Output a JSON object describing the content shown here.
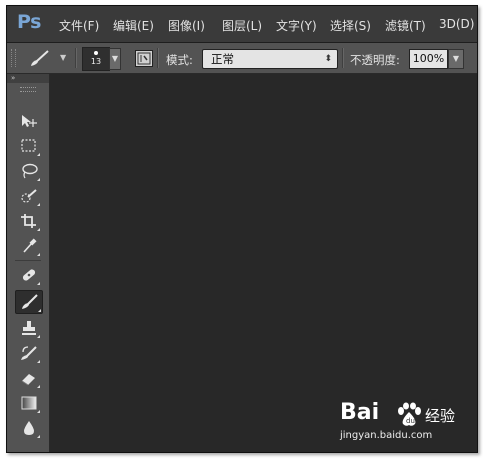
{
  "app": {
    "logo": "Ps"
  },
  "menu": [
    {
      "name": "file",
      "label": "文件(F)"
    },
    {
      "name": "edit",
      "label": "编辑(E)"
    },
    {
      "name": "image",
      "label": "图像(I)"
    },
    {
      "name": "layer",
      "label": "图层(L)"
    },
    {
      "name": "type",
      "label": "文字(Y)"
    },
    {
      "name": "select",
      "label": "选择(S)"
    },
    {
      "name": "filter",
      "label": "滤镜(T)"
    },
    {
      "name": "3d",
      "label": "3D(D)"
    }
  ],
  "options_bar": {
    "brush_size": "13",
    "mode_label": "模式:",
    "mode_value": "正常",
    "opacity_label": "不透明度:",
    "opacity_value": "100%"
  },
  "toolstrip": {
    "collapse_glyph": "»"
  },
  "tools": [
    "move-tool-icon",
    "marquee-tool-icon",
    "lasso-tool-icon",
    "quick-selection-tool-icon",
    "crop-tool-icon",
    "eyedropper-tool-icon",
    "spot-healing-tool-icon",
    "brush-tool-icon",
    "clone-stamp-tool-icon",
    "history-brush-tool-icon",
    "eraser-tool-icon",
    "gradient-tool-icon",
    "blur-tool-icon"
  ],
  "active_tool": "brush-tool-icon",
  "watermark": {
    "logo_text": "Bai",
    "brand_text": "经验",
    "url": "jingyan.baidu.com"
  },
  "colors": {
    "menubar": "#3a3a3a",
    "optionsbar": "#535353",
    "canvas": "#282828",
    "logo": "#7aa6d6"
  }
}
